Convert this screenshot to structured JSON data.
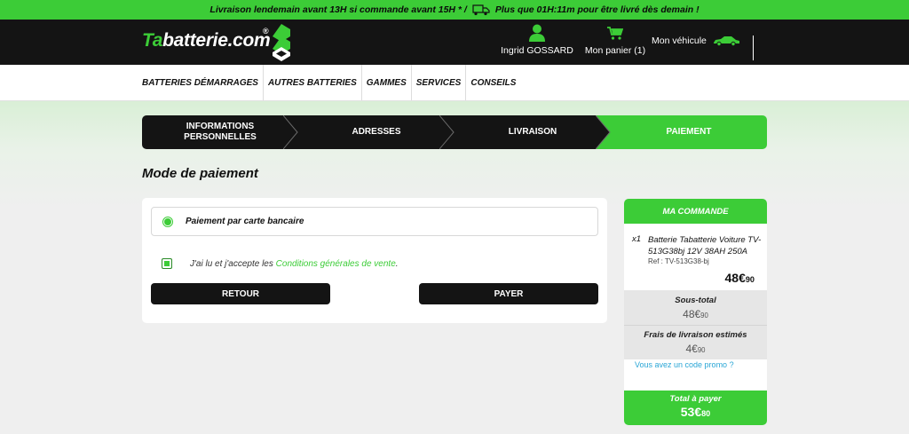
{
  "topbar": {
    "text_before": "Livraison lendemain avant 13H si commande avant 15H * /",
    "text_after": "Plus que 01H:11m pour être livré dès demain !"
  },
  "header": {
    "logo_ta": "Ta",
    "logo_rest": "batterie.com",
    "logo_reg": "®",
    "user_name": "Ingrid GOSSARD",
    "cart_label": "Mon panier (1)",
    "vehicle_label": "Mon véhicule"
  },
  "nav": {
    "items": [
      "BATTERIES DÉMARRAGES",
      "AUTRES BATTERIES",
      "GAMMES",
      "SERVICES",
      "CONSEILS"
    ]
  },
  "steps": [
    {
      "label": "INFORMATIONS PERSONNELLES"
    },
    {
      "label": "ADRESSES"
    },
    {
      "label": "LIVRAISON"
    },
    {
      "label": "PAIEMENT"
    }
  ],
  "page_title": "Mode de paiement",
  "payment": {
    "option_label": "Paiement par carte bancaire",
    "terms_text": "J'ai lu et j'accepte les",
    "terms_link": "Conditions générales de vente",
    "terms_end": ".",
    "back_label": "RETOUR",
    "pay_label": "PAYER"
  },
  "order": {
    "title": "MA COMMANDE",
    "qty": "x1",
    "product_name": "Batterie Tabatterie Voiture TV-513G38bj 12V 38AH 250A",
    "ref": "Ref : TV-513G38-bj",
    "price_int": "48€",
    "price_cents": "90",
    "subtotal_label": "Sous-total",
    "subtotal_int": "48€",
    "subtotal_cents": "90",
    "shipping_label": "Frais de livraison estimés",
    "shipping_int": "4€",
    "shipping_cents": "90",
    "promo_label": "Vous avez un code promo ?",
    "total_label": "Total à payer",
    "total_int": "53€",
    "total_cents": "80"
  },
  "colors": {
    "brand_green": "#3ccc37",
    "dark": "#141414",
    "link_blue": "#2aa6d6"
  }
}
